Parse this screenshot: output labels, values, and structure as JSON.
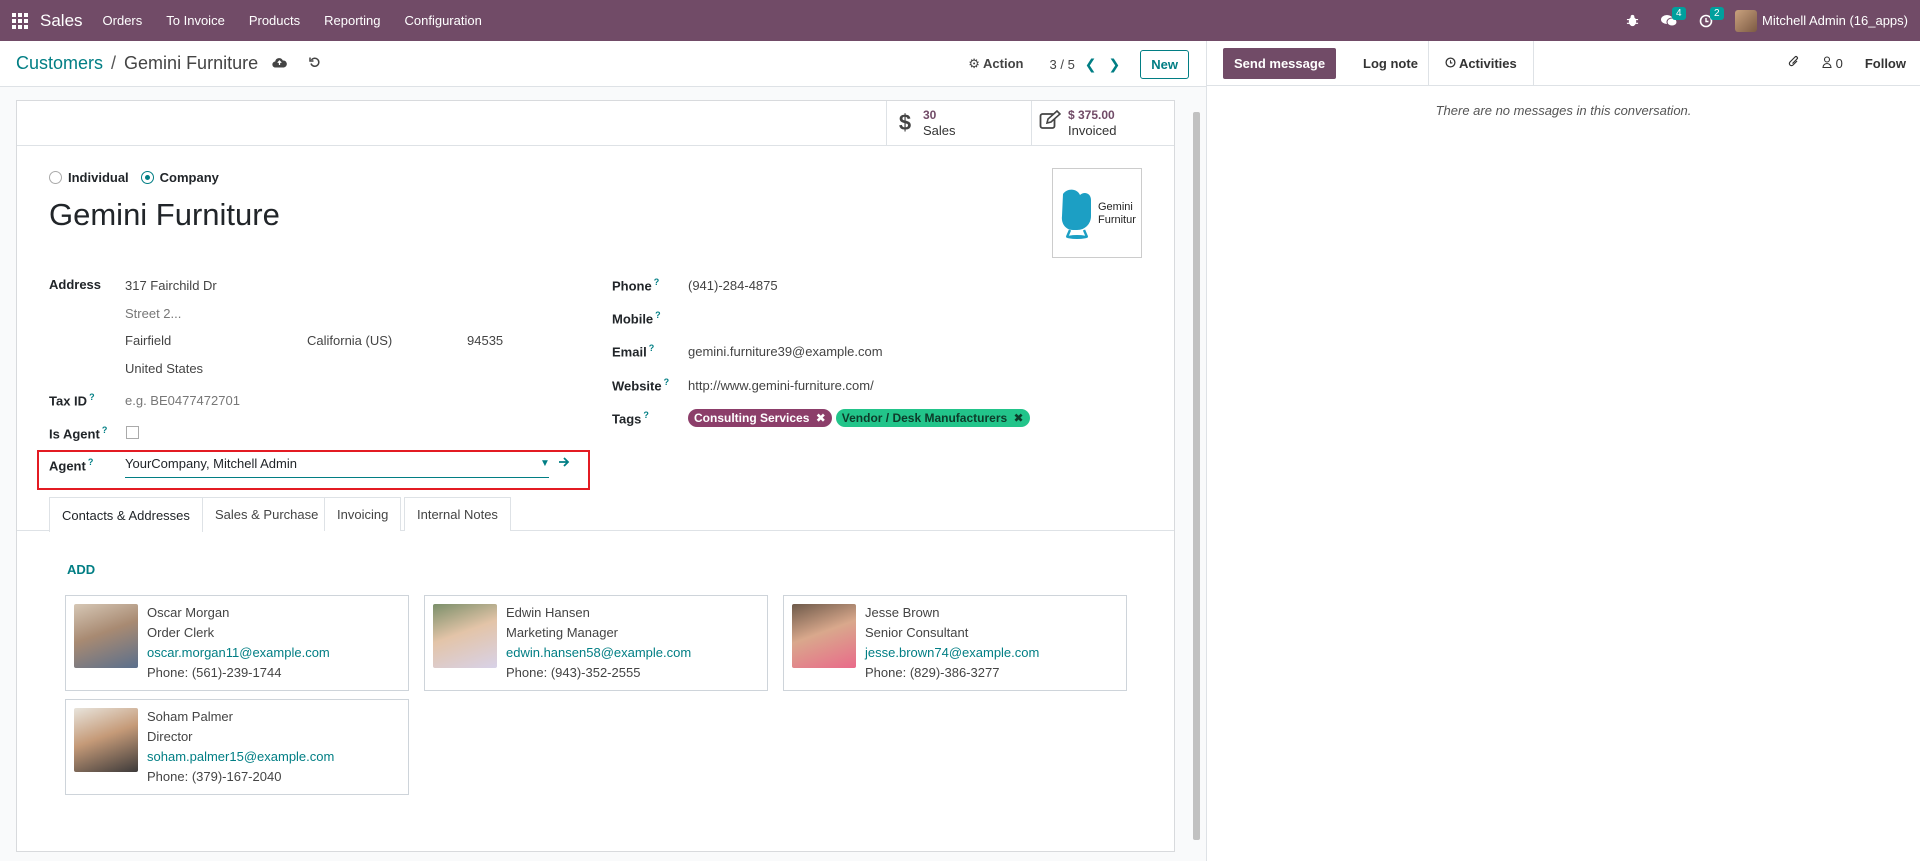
{
  "navbar": {
    "app_name": "Sales",
    "menus": [
      "Orders",
      "To Invoice",
      "Products",
      "Reporting",
      "Configuration"
    ],
    "messages_count": "4",
    "activities_count": "2",
    "user": "Mitchell Admin (16_apps)"
  },
  "breadcrumb": {
    "parent": "Customers",
    "separator": "/",
    "current": "Gemini Furniture"
  },
  "control": {
    "action_label": "Action",
    "pager": "3 / 5",
    "new_label": "New"
  },
  "chatter": {
    "send_message": "Send message",
    "log_note": "Log note",
    "activities": "Activities",
    "followers_count": "0",
    "follow": "Follow",
    "empty_text": "There are no messages in this conversation."
  },
  "stats": {
    "sales_value": "30",
    "sales_label": "Sales",
    "invoiced_value": "$ 375.00",
    "invoiced_label": "Invoiced"
  },
  "form": {
    "type_individual": "Individual",
    "type_company": "Company",
    "name": "Gemini Furniture",
    "logo_text_1": "Gemini",
    "logo_text_2": "Furniture",
    "address_label": "Address",
    "street": "317 Fairchild Dr",
    "street2_placeholder": "Street 2...",
    "city": "Fairfield",
    "state": "California (US)",
    "zip": "94535",
    "country": "United States",
    "tax_label": "Tax ID",
    "tax_placeholder": "e.g. BE0477472701",
    "is_agent_label": "Is Agent",
    "agent_label": "Agent",
    "agent_value": "YourCompany, Mitchell Admin",
    "phone_label": "Phone",
    "phone": "(941)-284-4875",
    "mobile_label": "Mobile",
    "email_label": "Email",
    "email": "gemini.furniture39@example.com",
    "website_label": "Website",
    "website": "http://www.gemini-furniture.com/",
    "tags_label": "Tags",
    "tags": [
      "Consulting Services",
      "Vendor / Desk Manufacturers"
    ],
    "help_mark": "?"
  },
  "tabs": [
    "Contacts & Addresses",
    "Sales & Purchase",
    "Invoicing",
    "Internal Notes"
  ],
  "contacts": {
    "add_label": "ADD",
    "items": [
      {
        "name": "Oscar Morgan",
        "role": "Order Clerk",
        "email": "oscar.morgan11@example.com",
        "phone": "Phone: (561)-239-1744"
      },
      {
        "name": "Edwin Hansen",
        "role": "Marketing Manager",
        "email": "edwin.hansen58@example.com",
        "phone": "Phone: (943)-352-2555"
      },
      {
        "name": "Jesse Brown",
        "role": "Senior Consultant",
        "email": "jesse.brown74@example.com",
        "phone": "Phone: (829)-386-3277"
      },
      {
        "name": "Soham Palmer",
        "role": "Director",
        "email": "soham.palmer15@example.com",
        "phone": "Phone: (379)-167-2040"
      }
    ]
  },
  "colors": {
    "brand": "#714b67",
    "accent": "#017e84",
    "tag_consulting": "#8c3e6a",
    "tag_vendor": "#22c48a",
    "highlight": "#e31b23"
  }
}
